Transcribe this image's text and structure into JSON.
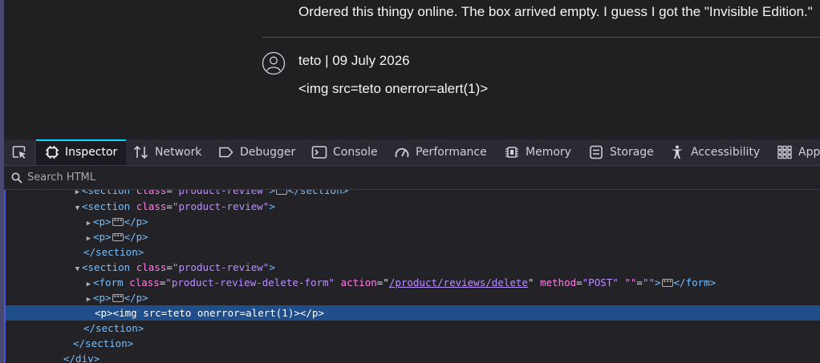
{
  "page": {
    "review_top_text": "Ordered this thingy online. The box arrived empty. I guess I got the \"Invisible Edition.\"",
    "review_meta": "teto | 09 July 2026",
    "review_body": "<img src=teto onerror=alert(1)>"
  },
  "devtools": {
    "tabs": [
      {
        "label": "Inspector",
        "icon": "inspector-icon"
      },
      {
        "label": "Network",
        "icon": "network-icon"
      },
      {
        "label": "Debugger",
        "icon": "debugger-icon"
      },
      {
        "label": "Console",
        "icon": "console-icon"
      },
      {
        "label": "Performance",
        "icon": "performance-icon"
      },
      {
        "label": "Memory",
        "icon": "memory-icon"
      },
      {
        "label": "Storage",
        "icon": "storage-icon"
      },
      {
        "label": "Accessibility",
        "icon": "accessibility-icon"
      },
      {
        "label": "App",
        "icon": "application-icon"
      }
    ],
    "search_placeholder": "Search HTML",
    "markup": {
      "l0_text": "<section class=\"product-review\">…</section>",
      "section_open": "<section",
      "section_close": "</section>",
      "p_open": "<p>",
      "p_close": "</p>",
      "close_bracket": ">",
      "class_attr": "class",
      "product_review_val": "\"product-review\"",
      "form_open": "<form",
      "form_close": "</form>",
      "form_class_val": "\"product-review-delete-form\"",
      "action_attr": "action",
      "action_val": "/product/reviews/delete",
      "method_attr": "method",
      "method_val": "\"POST\"",
      "empty_attr": "\"\"",
      "selected_text": "<img src=teto onerror=alert(1)>",
      "div_close": "</div>"
    }
  }
}
